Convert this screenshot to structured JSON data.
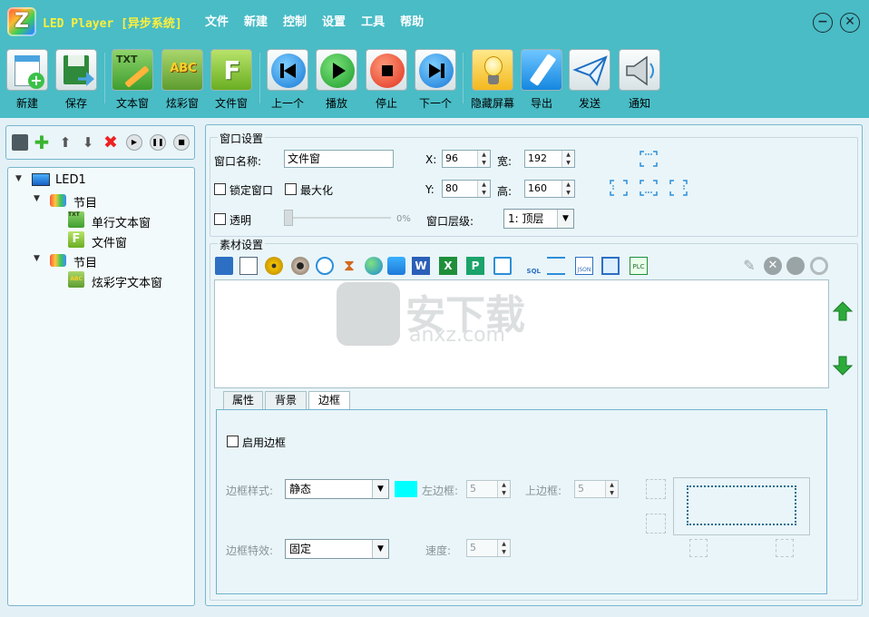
{
  "window": {
    "title": "LED Player [异步系统]",
    "menu": [
      "文件",
      "新建",
      "控制",
      "设置",
      "工具",
      "帮助"
    ],
    "minimize_glyph": "−",
    "close_glyph": "✕"
  },
  "toolbar": {
    "buttons": [
      {
        "label": "新建",
        "icon": "new-file-icon"
      },
      {
        "label": "保存",
        "icon": "save-icon"
      },
      {
        "label": "文本窗",
        "icon": "text-window-icon",
        "icon_text": "TXT"
      },
      {
        "label": "炫彩窗",
        "icon": "colorful-text-icon",
        "icon_text": "ABC"
      },
      {
        "label": "文件窗",
        "icon": "file-window-icon",
        "icon_text": "F"
      },
      {
        "label": "上一个",
        "icon": "previous-icon"
      },
      {
        "label": "播放",
        "icon": "play-icon"
      },
      {
        "label": "停止",
        "icon": "stop-icon"
      },
      {
        "label": "下一个",
        "icon": "next-icon"
      },
      {
        "label": "隐藏屏幕",
        "icon": "hide-screen-icon"
      },
      {
        "label": "导出",
        "icon": "export-usb-icon"
      },
      {
        "label": "发送",
        "icon": "send-icon"
      },
      {
        "label": "通知",
        "icon": "notify-icon"
      }
    ]
  },
  "tree": {
    "root": "LED1",
    "programs": [
      {
        "label": "节目",
        "children": [
          "单行文本窗",
          "文件窗"
        ]
      },
      {
        "label": "节目",
        "children": [
          "炫彩字文本窗"
        ]
      }
    ]
  },
  "window_settings": {
    "group_title": "窗口设置",
    "name_label": "窗口名称:",
    "name_value": "文件窗",
    "x_label": "X:",
    "x_value": "96",
    "y_label": "Y:",
    "y_value": "80",
    "width_label": "宽:",
    "width_value": "192",
    "height_label": "高:",
    "height_value": "160",
    "lock_label": "锁定窗口",
    "maximize_label": "最大化",
    "transparent_label": "透明",
    "transparency_value": "0%",
    "layer_label": "窗口层级:",
    "layer_value": "1: 顶层"
  },
  "material_settings": {
    "group_title": "素材设置",
    "toolbar_icons": [
      "edit-icon",
      "document-icon",
      "dvd-icon",
      "webcam-icon",
      "clock-icon",
      "hourglass-icon",
      "globe-icon",
      "weather-icon",
      "word-icon",
      "excel-icon",
      "powerpoint-icon",
      "device-icon",
      "database-sql-icon",
      "network-icon",
      "json-icon",
      "monitor-icon",
      "plc-icon"
    ],
    "sql_text": "SQL",
    "json_text": "JSON",
    "plc_text": "PLC",
    "word_letter": "W",
    "excel_letter": "X",
    "ppt_letter": "P"
  },
  "watermark": {
    "text": "安下载",
    "domain": "anxz.com"
  },
  "tabs": [
    "属性",
    "背景",
    "边框"
  ],
  "active_tab": "边框",
  "border": {
    "enable_label": "启用边框",
    "style_label": "边框样式:",
    "style_value": "静态",
    "effect_label": "边框特效:",
    "effect_value": "固定",
    "color": "#00ffff",
    "left_label": "左边框:",
    "left_value": "5",
    "top_label": "上边框:",
    "top_value": "5",
    "speed_label": "速度:",
    "speed_value": "5"
  }
}
